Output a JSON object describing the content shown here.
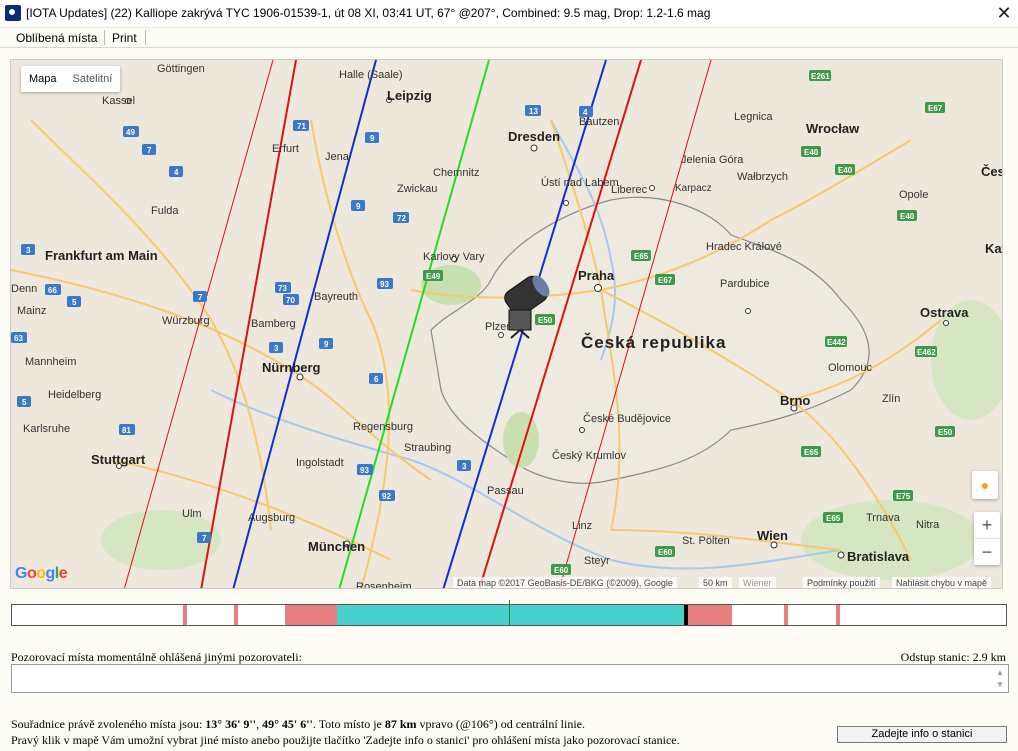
{
  "window": {
    "title": "[IOTA Updates] (22) Kalliope zakrývá TYC 1906-01539-1, út 08 XI, 03:41 UT, 67° @207°, Combined:  9.5 mag, Drop: 1.2-1.6 mag",
    "close_symbol": "✕"
  },
  "menu": {
    "favorites": "Oblíbená místa",
    "print": "Print"
  },
  "map": {
    "type_map": "Mapa",
    "type_satellite": "Satelitní",
    "country_label": "Česká republika",
    "cities": [
      {
        "name": "Göttingen"
      },
      {
        "name": "Halle (Saale)"
      },
      {
        "name": "Leipzig"
      },
      {
        "name": "Dresden"
      },
      {
        "name": "Bautzen"
      },
      {
        "name": "Legnica"
      },
      {
        "name": "Wrocław"
      },
      {
        "name": "Kassel"
      },
      {
        "name": "Erfurt"
      },
      {
        "name": "Jena"
      },
      {
        "name": "Chemnitz"
      },
      {
        "name": "Zwickau"
      },
      {
        "name": "Ústí nad Labem"
      },
      {
        "name": "Liberec"
      },
      {
        "name": "Jelenia Góra"
      },
      {
        "name": "Karpacz"
      },
      {
        "name": "Wałbrzych"
      },
      {
        "name": "Opole"
      },
      {
        "name": "Fulda"
      },
      {
        "name": "Frankfurt am Main"
      },
      {
        "name": "Karlovy Vary"
      },
      {
        "name": "Praha"
      },
      {
        "name": "Hradec Králové"
      },
      {
        "name": "Pardubice"
      },
      {
        "name": "Bayreuth"
      },
      {
        "name": "Würzburg"
      },
      {
        "name": "Bamberg"
      },
      {
        "name": "Plzeň"
      },
      {
        "name": "Ostrava"
      },
      {
        "name": "Mainz"
      },
      {
        "name": "Mannheim"
      },
      {
        "name": "Nürnberg"
      },
      {
        "name": "Olomouc"
      },
      {
        "name": "Heidelberg"
      },
      {
        "name": "Regensburg"
      },
      {
        "name": "Brno"
      },
      {
        "name": "Zlín"
      },
      {
        "name": "Karlsruhe"
      },
      {
        "name": "České Budějovice"
      },
      {
        "name": "Straubing"
      },
      {
        "name": "Stuttgart"
      },
      {
        "name": "Ingolstadt"
      },
      {
        "name": "Český Krumlov"
      },
      {
        "name": "Passau"
      },
      {
        "name": "Ulm"
      },
      {
        "name": "Augsburg"
      },
      {
        "name": "Linz"
      },
      {
        "name": "Trnava"
      },
      {
        "name": "Nitra"
      },
      {
        "name": "München"
      },
      {
        "name": "Wien"
      },
      {
        "name": "St. Pölten"
      },
      {
        "name": "Steyr"
      },
      {
        "name": "Bratislava"
      },
      {
        "name": "Rosenheim"
      },
      {
        "name": "Česk"
      },
      {
        "name": "Kat"
      },
      {
        "name": "Denn"
      }
    ],
    "attribution": "Data map ©2017 GeoBasis-DE/BKG (©2009), Google",
    "scale": "50 km",
    "scale_town": "Wiener",
    "terms": "Podmínky použití",
    "report": "Nahlásit chybu v mapě",
    "logo": "Google"
  },
  "timeline": {
    "segments": [
      {
        "start": 0.172,
        "end": 0.176,
        "color": "#e87f7f"
      },
      {
        "start": 0.223,
        "end": 0.227,
        "color": "#e87f7f"
      },
      {
        "start": 0.275,
        "end": 0.327,
        "color": "#e87f7f"
      },
      {
        "start": 0.327,
        "end": 0.676,
        "color": "#48d1cc"
      },
      {
        "start": 0.676,
        "end": 0.68,
        "color": "#000000"
      },
      {
        "start": 0.68,
        "end": 0.724,
        "color": "#e87f7f"
      },
      {
        "start": 0.777,
        "end": 0.781,
        "color": "#e87f7f"
      },
      {
        "start": 0.829,
        "end": 0.833,
        "color": "#e87f7f"
      }
    ],
    "center_line": 0.5
  },
  "observers": {
    "label": "Pozorovací místa momentálně ohlášená jinými pozorovateli:",
    "spacing": "Odstup stanic: 2.9 km"
  },
  "selection": {
    "prefix": "Souřadnice právě zvoleného místa jsou: ",
    "lon": "13° 36' 9''",
    "sep": ", ",
    "lat": "49° 45' 6''",
    "mid": ". Toto místo je ",
    "dist": "87 km",
    "suffix": " vpravo (@106°) od centrální linie.",
    "hint": "Pravý klik v mapě Vám umožní vybrat jiné místo anebo použijte tlačítko 'Zadejte info o stanici' pro ohlášení místa jako pozorovací stanice."
  },
  "buttons": {
    "enter_station": "Zadejte info o stanici"
  },
  "colors": {
    "path_center": "#22dd22",
    "path_limits": "#1030d0",
    "sigma_lines": "#dd1111",
    "highlight": "#48d1cc"
  }
}
